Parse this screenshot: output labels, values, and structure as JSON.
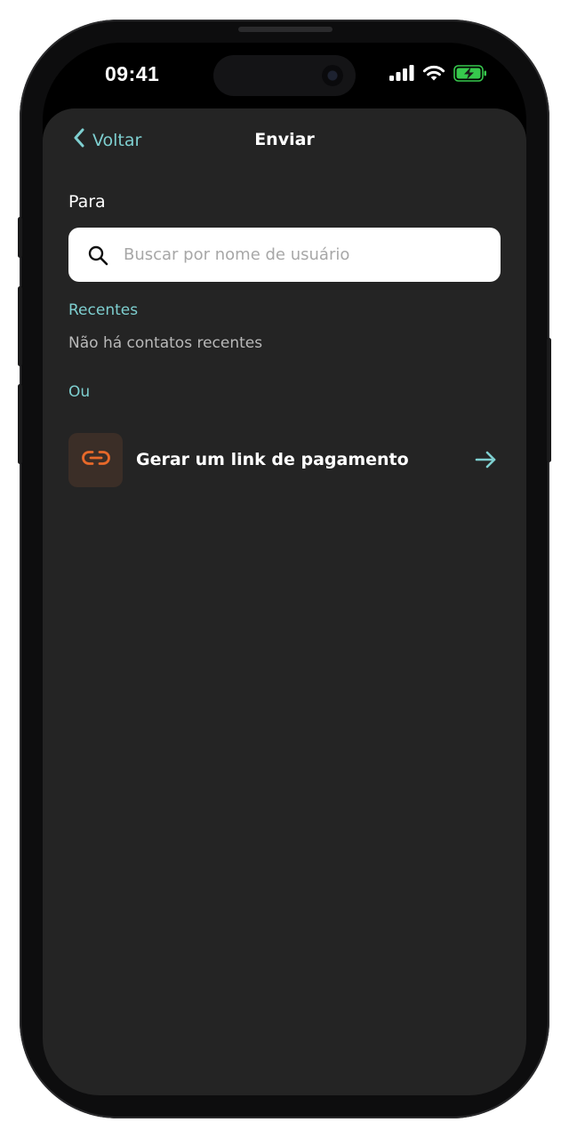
{
  "status_bar": {
    "time": "09:41",
    "icons": [
      "cellular-signal-icon",
      "wifi-icon",
      "battery-charging-icon"
    ]
  },
  "nav": {
    "back_label": "Voltar",
    "title": "Enviar"
  },
  "recipient": {
    "label": "Para",
    "search_placeholder": "Buscar por nome de usuário",
    "search_value": ""
  },
  "recents": {
    "heading": "Recentes",
    "empty_text": "Não há contatos recentes"
  },
  "alternative": {
    "heading": "Ou",
    "payment_link_label": "Gerar um link de pagamento",
    "icon": "link-icon",
    "action_icon": "arrow-right-icon"
  },
  "colors": {
    "accent": "#7ecfd0",
    "link_icon": "#e8692a",
    "background": "#242424",
    "battery": "#37c94d"
  }
}
